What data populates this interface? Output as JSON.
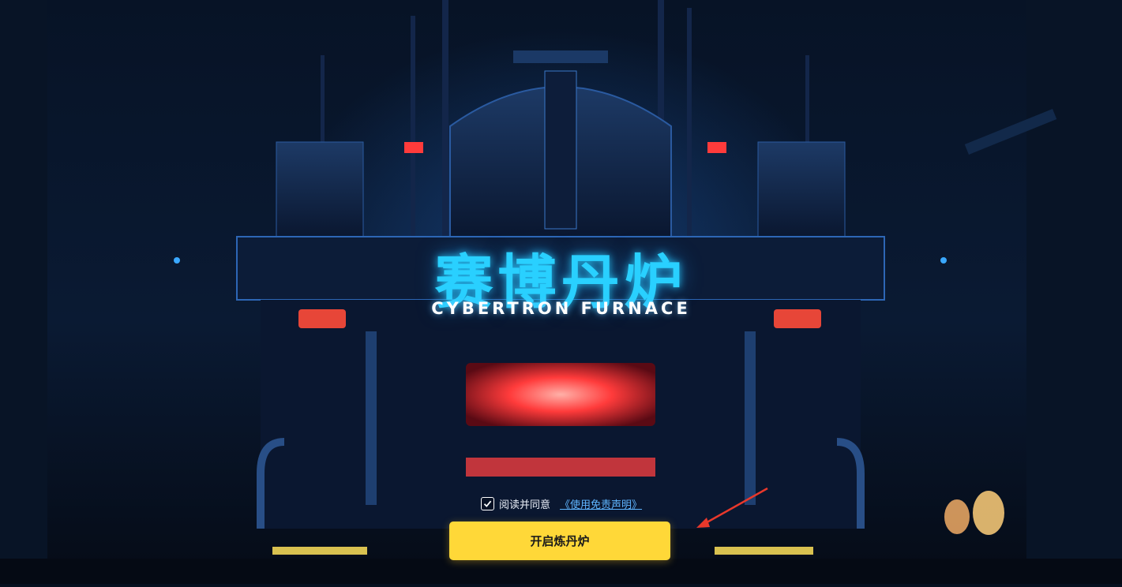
{
  "hero": {
    "title": "赛博丹炉",
    "subtitle": "CYBERTRON FURNACE"
  },
  "agreement": {
    "checked": true,
    "text": "阅读并同意",
    "link_text": "《使用免责声明》"
  },
  "start_button": {
    "label": "开启炼丹炉"
  },
  "colors": {
    "title_glow": "#29d0ff",
    "button_bg": "#ffd838",
    "link": "#5fb5ff",
    "arrow": "#e8382b"
  },
  "icons": [
    "checkmark-icon",
    "arrow-annotation-icon"
  ]
}
